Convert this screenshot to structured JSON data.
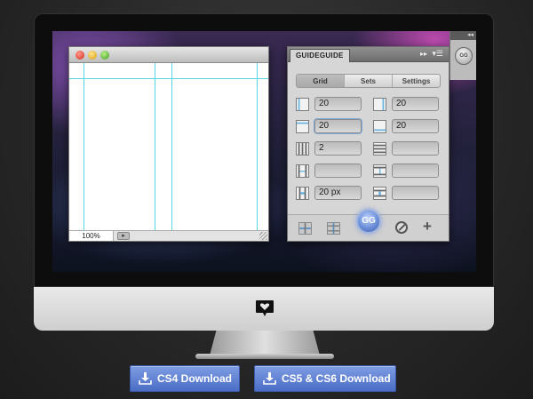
{
  "document_window": {
    "zoom": "100%"
  },
  "panel": {
    "tab_title": "GUIDEGUIDE",
    "collapse_glyph": "▸▸",
    "menu_glyph": "▾☰",
    "segments": [
      {
        "label": "Grid",
        "active": true
      },
      {
        "label": "Sets",
        "active": false
      },
      {
        "label": "Settings",
        "active": false
      }
    ],
    "rows": [
      {
        "left_icon": "margin-left-icon",
        "left_value": "20",
        "right_icon": "margin-right-icon",
        "right_value": "20"
      },
      {
        "left_icon": "margin-top-icon",
        "left_value": "20",
        "right_icon": "margin-bottom-icon",
        "right_value": "20"
      },
      {
        "left_icon": "columns-icon",
        "left_value": "2",
        "right_icon": "rows-icon",
        "right_value": ""
      },
      {
        "left_icon": "column-width-icon",
        "left_value": "",
        "right_icon": "row-height-icon",
        "right_value": ""
      },
      {
        "left_icon": "column-gutter-icon",
        "left_value": "20 px",
        "right_icon": "row-gutter-icon",
        "right_value": ""
      }
    ],
    "gg_button_label": "GG",
    "add_glyph": "+"
  },
  "dock": {
    "top_glyph": "◂◂",
    "button_label": "GG"
  },
  "downloads": {
    "cs4_label": "CS4 Download",
    "cs5_label": "CS5 & CS6 Download"
  },
  "colors": {
    "guide": "#55d7e6",
    "download_button": "#5a7bd0",
    "gg_button": "#6c8fd8"
  }
}
